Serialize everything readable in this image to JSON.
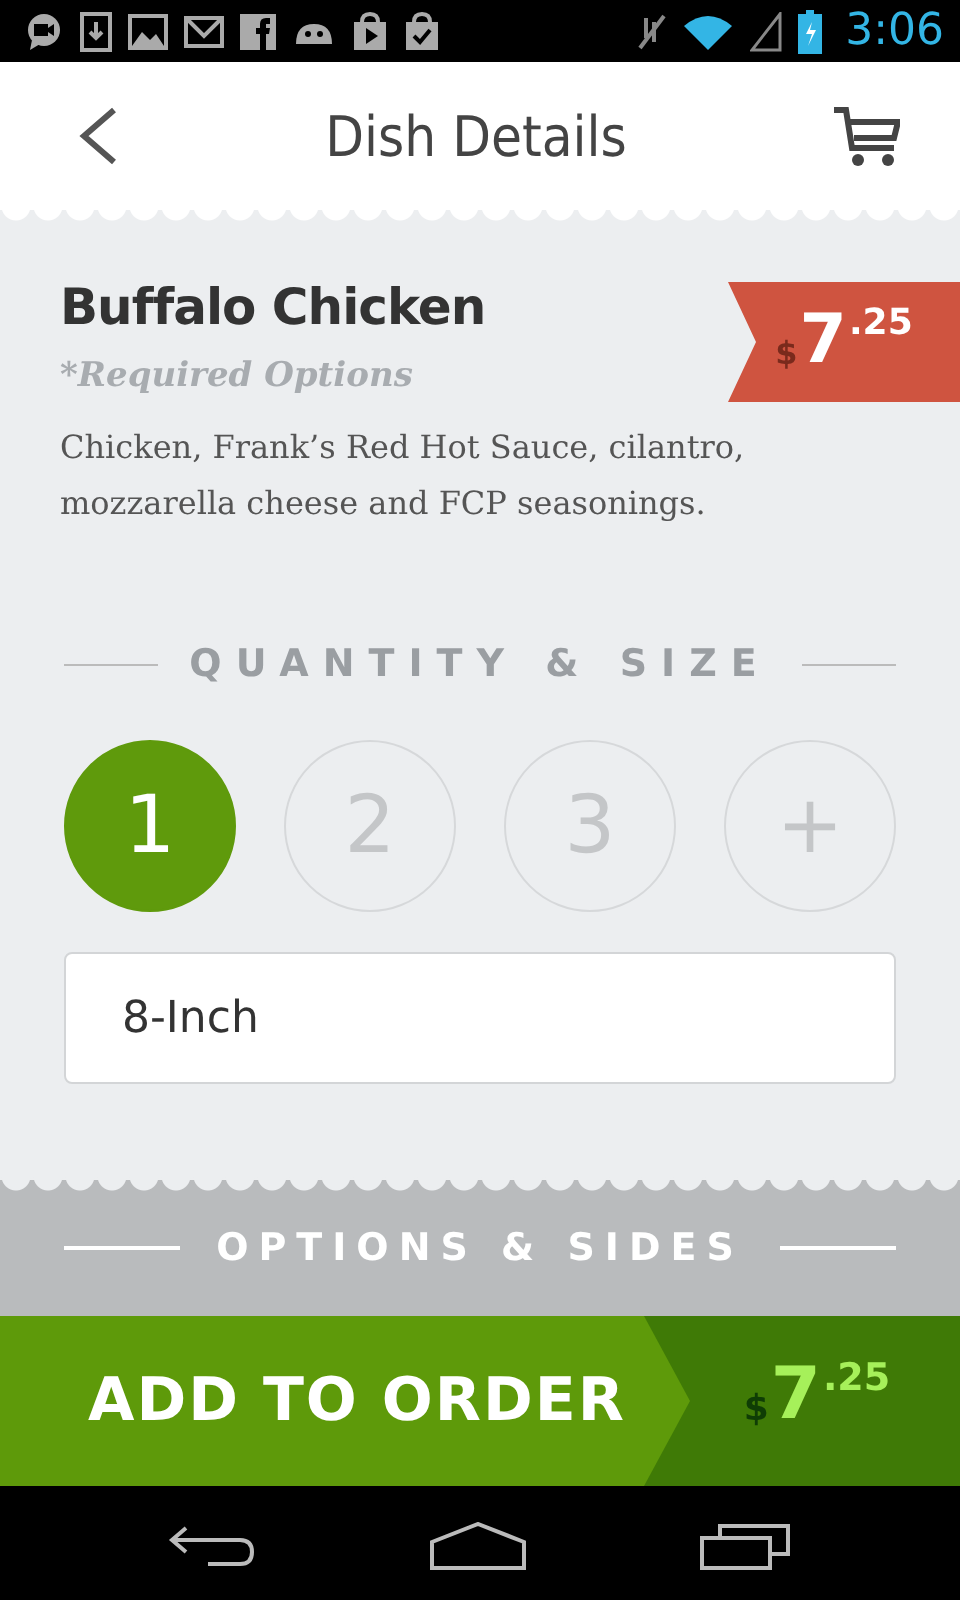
{
  "status_bar": {
    "time": "3:06"
  },
  "header": {
    "title": "Dish Details"
  },
  "dish": {
    "name": "Buffalo Chicken",
    "required_note": "*Required Options",
    "description": "Chicken, Frank’s Red Hot Sauce, cilantro, mozzarella cheese and FCP seasonings.",
    "price": {
      "currency": "$",
      "dollars": "7",
      "cents": ".25"
    }
  },
  "quantity_section": {
    "heading": "QUANTITY & SIZE",
    "options": [
      {
        "label": "1",
        "selected": true
      },
      {
        "label": "2",
        "selected": false
      },
      {
        "label": "3",
        "selected": false
      }
    ],
    "more_label": "+",
    "size_value": "8-Inch"
  },
  "options_section": {
    "heading": "OPTIONS & SIDES"
  },
  "order_bar": {
    "label": "ADD TO ORDER",
    "price": {
      "currency": "$",
      "dollars": "7",
      "cents": ".25"
    }
  }
}
